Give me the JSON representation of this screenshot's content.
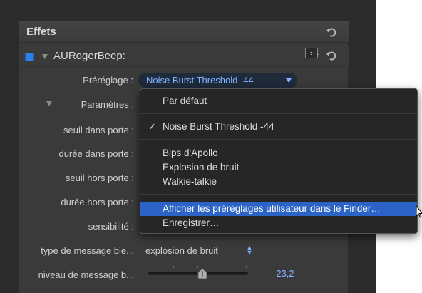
{
  "panel": {
    "title": "Effets",
    "plugin_name": "AURogerBeep:",
    "plugin_enabled": true,
    "fx_icon_label": "-:-."
  },
  "params": {
    "preset_label": "Préréglage :",
    "preset_value": "Noise Burst Threshold -44",
    "parameters_label": "Paramètres :",
    "rows": [
      {
        "label": "seuil dans porte :"
      },
      {
        "label": "durée dans porte :"
      },
      {
        "label": "seuil hors porte :"
      },
      {
        "label": "durée hors porte :"
      },
      {
        "label": "sensibilité :"
      },
      {
        "label": "type de message bie...",
        "value": "explosion de bruit"
      },
      {
        "label": "niveau de message b...",
        "value": "-23,2"
      }
    ]
  },
  "menu": {
    "default_label": "Par défaut",
    "checked_item": "Noise Burst Threshold -44",
    "items": [
      "Bips d'Apollo",
      "Explosion de bruit",
      "Walkie-talkie"
    ],
    "finder_item": "Afficher les préréglages utilisateur dans le Finder…",
    "save_item": "Enregistrer…"
  },
  "colors": {
    "accent": "#7fb3ff",
    "highlight": "#2b63c7",
    "checkbox": "#2f7fe8"
  }
}
